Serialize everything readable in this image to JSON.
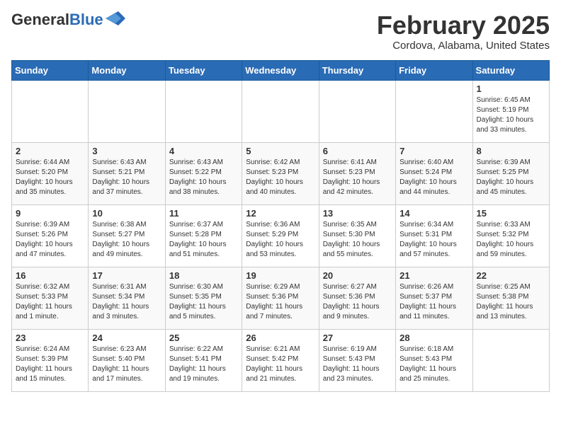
{
  "logo": {
    "general": "General",
    "blue": "Blue"
  },
  "header": {
    "title": "February 2025",
    "subtitle": "Cordova, Alabama, United States"
  },
  "weekdays": [
    "Sunday",
    "Monday",
    "Tuesday",
    "Wednesday",
    "Thursday",
    "Friday",
    "Saturday"
  ],
  "weeks": [
    [
      {
        "day": "",
        "info": ""
      },
      {
        "day": "",
        "info": ""
      },
      {
        "day": "",
        "info": ""
      },
      {
        "day": "",
        "info": ""
      },
      {
        "day": "",
        "info": ""
      },
      {
        "day": "",
        "info": ""
      },
      {
        "day": "1",
        "info": "Sunrise: 6:45 AM\nSunset: 5:19 PM\nDaylight: 10 hours and 33 minutes."
      }
    ],
    [
      {
        "day": "2",
        "info": "Sunrise: 6:44 AM\nSunset: 5:20 PM\nDaylight: 10 hours and 35 minutes."
      },
      {
        "day": "3",
        "info": "Sunrise: 6:43 AM\nSunset: 5:21 PM\nDaylight: 10 hours and 37 minutes."
      },
      {
        "day": "4",
        "info": "Sunrise: 6:43 AM\nSunset: 5:22 PM\nDaylight: 10 hours and 38 minutes."
      },
      {
        "day": "5",
        "info": "Sunrise: 6:42 AM\nSunset: 5:23 PM\nDaylight: 10 hours and 40 minutes."
      },
      {
        "day": "6",
        "info": "Sunrise: 6:41 AM\nSunset: 5:23 PM\nDaylight: 10 hours and 42 minutes."
      },
      {
        "day": "7",
        "info": "Sunrise: 6:40 AM\nSunset: 5:24 PM\nDaylight: 10 hours and 44 minutes."
      },
      {
        "day": "8",
        "info": "Sunrise: 6:39 AM\nSunset: 5:25 PM\nDaylight: 10 hours and 45 minutes."
      }
    ],
    [
      {
        "day": "9",
        "info": "Sunrise: 6:39 AM\nSunset: 5:26 PM\nDaylight: 10 hours and 47 minutes."
      },
      {
        "day": "10",
        "info": "Sunrise: 6:38 AM\nSunset: 5:27 PM\nDaylight: 10 hours and 49 minutes."
      },
      {
        "day": "11",
        "info": "Sunrise: 6:37 AM\nSunset: 5:28 PM\nDaylight: 10 hours and 51 minutes."
      },
      {
        "day": "12",
        "info": "Sunrise: 6:36 AM\nSunset: 5:29 PM\nDaylight: 10 hours and 53 minutes."
      },
      {
        "day": "13",
        "info": "Sunrise: 6:35 AM\nSunset: 5:30 PM\nDaylight: 10 hours and 55 minutes."
      },
      {
        "day": "14",
        "info": "Sunrise: 6:34 AM\nSunset: 5:31 PM\nDaylight: 10 hours and 57 minutes."
      },
      {
        "day": "15",
        "info": "Sunrise: 6:33 AM\nSunset: 5:32 PM\nDaylight: 10 hours and 59 minutes."
      }
    ],
    [
      {
        "day": "16",
        "info": "Sunrise: 6:32 AM\nSunset: 5:33 PM\nDaylight: 11 hours and 1 minute."
      },
      {
        "day": "17",
        "info": "Sunrise: 6:31 AM\nSunset: 5:34 PM\nDaylight: 11 hours and 3 minutes."
      },
      {
        "day": "18",
        "info": "Sunrise: 6:30 AM\nSunset: 5:35 PM\nDaylight: 11 hours and 5 minutes."
      },
      {
        "day": "19",
        "info": "Sunrise: 6:29 AM\nSunset: 5:36 PM\nDaylight: 11 hours and 7 minutes."
      },
      {
        "day": "20",
        "info": "Sunrise: 6:27 AM\nSunset: 5:36 PM\nDaylight: 11 hours and 9 minutes."
      },
      {
        "day": "21",
        "info": "Sunrise: 6:26 AM\nSunset: 5:37 PM\nDaylight: 11 hours and 11 minutes."
      },
      {
        "day": "22",
        "info": "Sunrise: 6:25 AM\nSunset: 5:38 PM\nDaylight: 11 hours and 13 minutes."
      }
    ],
    [
      {
        "day": "23",
        "info": "Sunrise: 6:24 AM\nSunset: 5:39 PM\nDaylight: 11 hours and 15 minutes."
      },
      {
        "day": "24",
        "info": "Sunrise: 6:23 AM\nSunset: 5:40 PM\nDaylight: 11 hours and 17 minutes."
      },
      {
        "day": "25",
        "info": "Sunrise: 6:22 AM\nSunset: 5:41 PM\nDaylight: 11 hours and 19 minutes."
      },
      {
        "day": "26",
        "info": "Sunrise: 6:21 AM\nSunset: 5:42 PM\nDaylight: 11 hours and 21 minutes."
      },
      {
        "day": "27",
        "info": "Sunrise: 6:19 AM\nSunset: 5:43 PM\nDaylight: 11 hours and 23 minutes."
      },
      {
        "day": "28",
        "info": "Sunrise: 6:18 AM\nSunset: 5:43 PM\nDaylight: 11 hours and 25 minutes."
      },
      {
        "day": "",
        "info": ""
      }
    ]
  ]
}
